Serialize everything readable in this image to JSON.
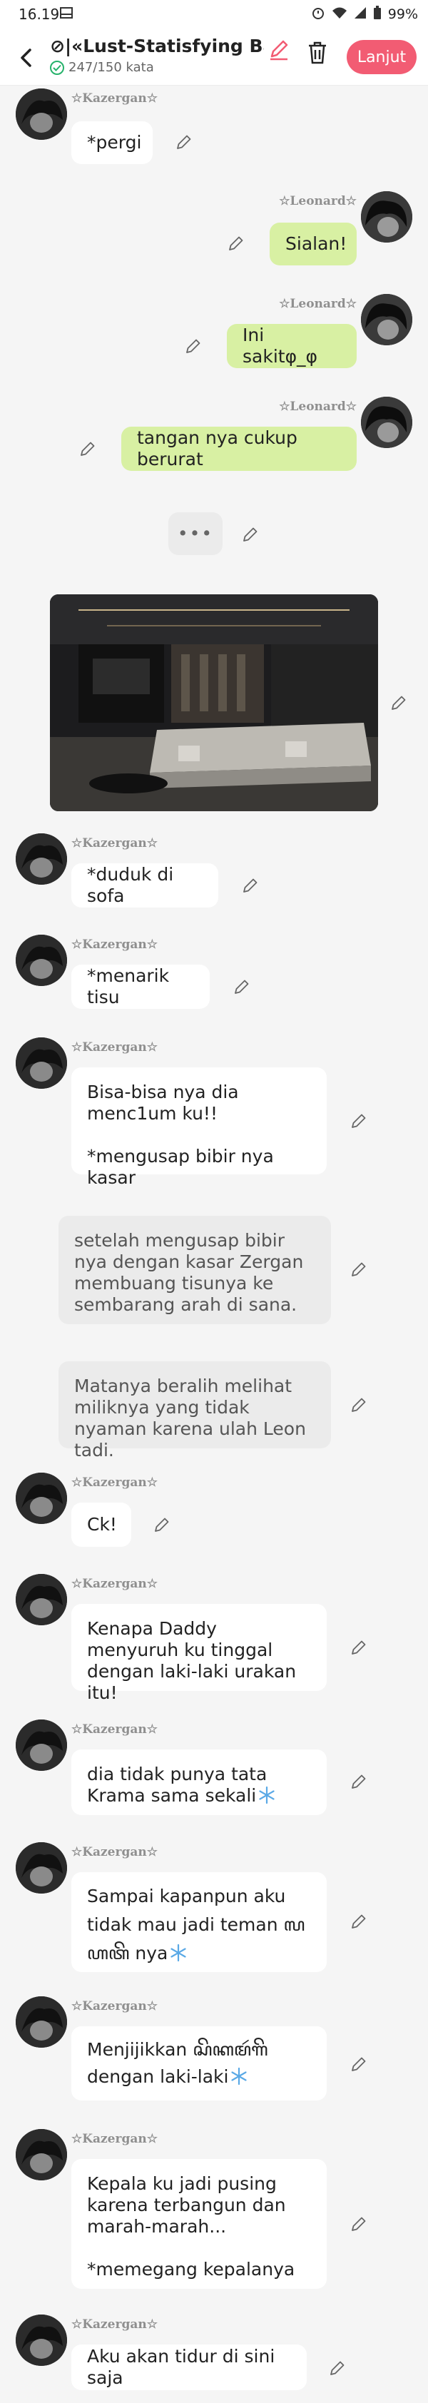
{
  "status_bar": {
    "time": "16.19",
    "battery": "99%"
  },
  "header": {
    "title": "⊘|«Lust-Statisfying Badm...",
    "word_count": "247/150 kata",
    "next_label": "Lanjut"
  },
  "characters": {
    "kazergan": "☆Kazergan☆",
    "leonard": "☆Leonard☆"
  },
  "messages": [
    {
      "speaker": "kazergan",
      "text": "*pergi"
    },
    {
      "speaker": "leonard",
      "text": "Sialan!"
    },
    {
      "speaker": "leonard",
      "text": "Ini sakitφ_φ"
    },
    {
      "speaker": "leonard",
      "text": "tangan nya cukup berurat"
    },
    {
      "speaker": "typing",
      "text": "•••"
    },
    {
      "speaker": "image",
      "text": ""
    },
    {
      "speaker": "kazergan",
      "text": "*duduk di sofa"
    },
    {
      "speaker": "kazergan",
      "text": "*menarik tisu"
    },
    {
      "speaker": "kazergan",
      "text": "Bisa-bisa nya dia menc1um ku!!\n\n*mengusap bibir nya kasar"
    },
    {
      "speaker": "narration",
      "text": "setelah mengusap bibir nya dengan kasar Zergan membuang tisunya ke sembarang arah di sana."
    },
    {
      "speaker": "narration",
      "text": "Matanya beralih melihat miliknya yang tidak nyaman karena ulah Leon tadi."
    },
    {
      "speaker": "kazergan",
      "text": "Ck!"
    },
    {
      "speaker": "kazergan",
      "text": "Kenapa Daddy menyuruh ku tinggal dengan laki-laki urakan itu!"
    },
    {
      "speaker": "kazergan",
      "text": "dia tidak punya tata Krama sama sekali"
    },
    {
      "speaker": "kazergan",
      "text": "Sampai kapanpun aku tidak mau jadi teman ꦭꦲꦠꦼ nya"
    },
    {
      "speaker": "kazergan",
      "text": "Menjijikkan ꦱꦼꦏꦩꦂꦒꦼ dengan laki-laki"
    },
    {
      "speaker": "kazergan",
      "text": "Kepala ku jadi pusing karena terbangun dan marah-marah...\n\n*memegang kepalanya"
    },
    {
      "speaker": "kazergan",
      "text": "Aku akan tidur di sini saja"
    }
  ],
  "icons": {
    "back": "chevron-left-icon",
    "edit": "pencil-icon",
    "delete": "trash-icon",
    "snowflake": "snowflake-icon",
    "check": "check-circle-icon"
  },
  "colors": {
    "accent": "#f25c73",
    "user_bubble": "#d8f0a3",
    "narration_bubble": "#ebebeb",
    "check": "#26b26b"
  }
}
